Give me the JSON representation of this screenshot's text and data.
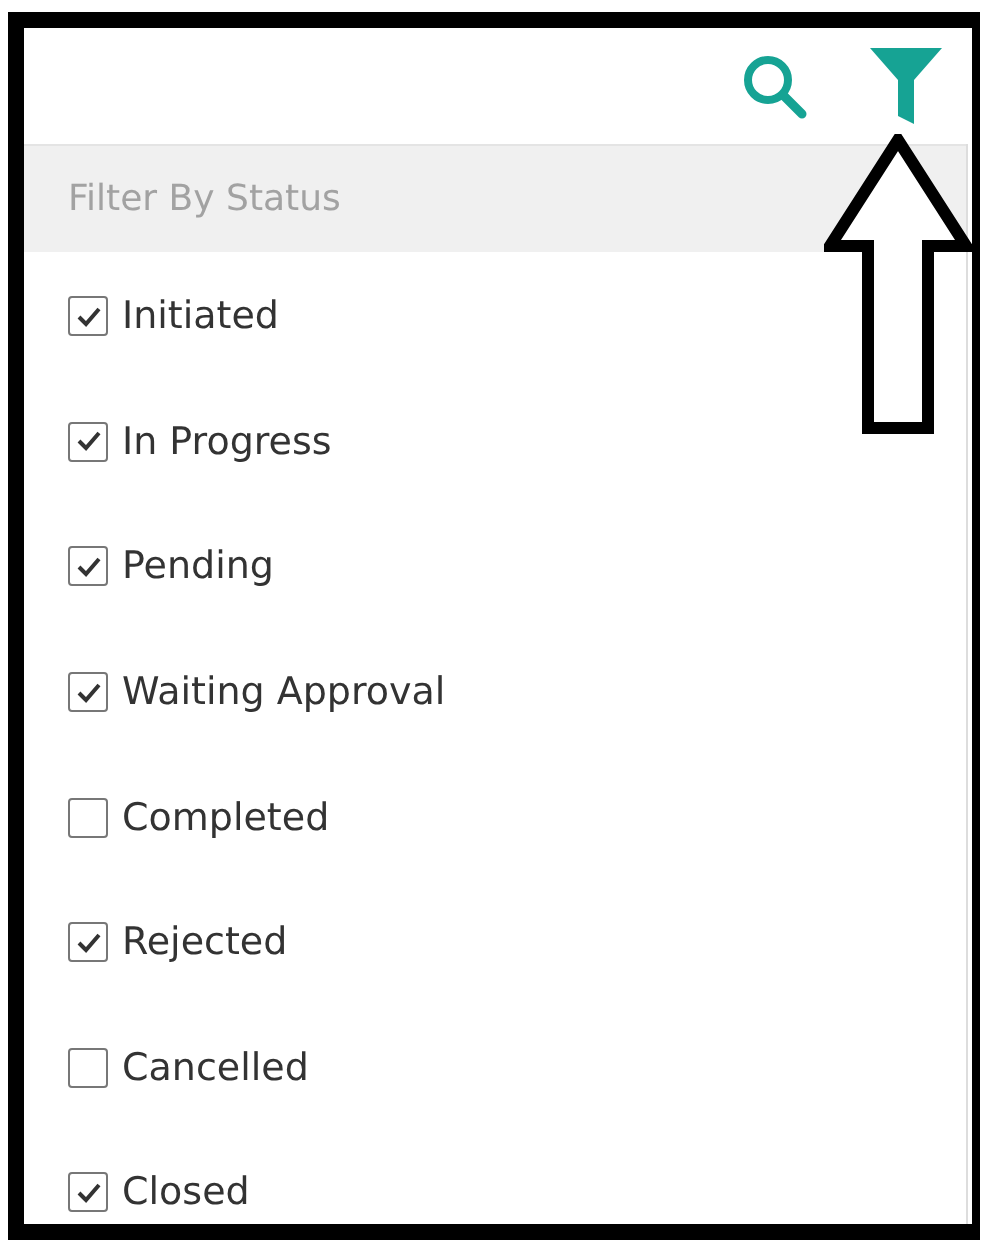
{
  "toolbar": {
    "buttons": [
      {
        "kind": "search"
      },
      {
        "kind": "filter"
      }
    ]
  },
  "filter_panel": {
    "title": "Filter By Status",
    "items": [
      {
        "label": "Initiated",
        "checked": true
      },
      {
        "label": "In Progress",
        "checked": true
      },
      {
        "label": "Pending",
        "checked": true
      },
      {
        "label": "Waiting Approval",
        "checked": true
      },
      {
        "label": "Completed",
        "checked": false
      },
      {
        "label": "Rejected",
        "checked": true
      },
      {
        "label": "Cancelled",
        "checked": false
      },
      {
        "label": "Closed",
        "checked": true
      }
    ]
  }
}
